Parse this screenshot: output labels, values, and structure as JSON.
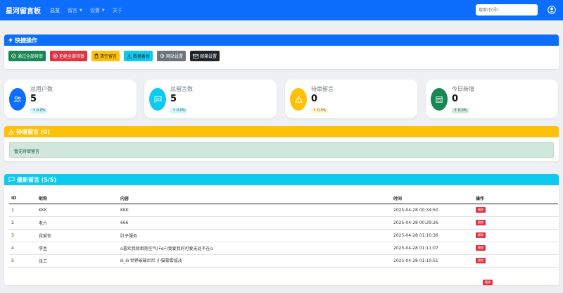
{
  "navbar": {
    "brand": "星河留言板",
    "items": [
      {
        "label": "总览",
        "active": true,
        "dropdown": false
      },
      {
        "label": "留言",
        "active": false,
        "dropdown": true
      },
      {
        "label": "设置",
        "active": false,
        "dropdown": true
      },
      {
        "label": "关于",
        "active": false,
        "dropdown": false
      }
    ],
    "search_placeholder": "搜索(仅号)",
    "user_icon": "person-circle-icon"
  },
  "quick_actions": {
    "title": "快捷操作",
    "buttons": [
      {
        "label": "通过全部待审",
        "color": "#198754",
        "icon": "check-circle-icon"
      },
      {
        "label": "拒绝全部待审",
        "color": "#dc3545",
        "icon": "x-circle-icon"
      },
      {
        "label": "清空留言",
        "color": "#ffc107",
        "icon": "trash-icon"
      },
      {
        "label": "数据备份",
        "color": "#0dcaf0",
        "icon": "download-icon"
      },
      {
        "label": "网站设置",
        "color": "#6c757d",
        "icon": "gear-icon"
      },
      {
        "label": "邮箱设置",
        "color": "#212529",
        "icon": "envelope-icon"
      }
    ]
  },
  "stats": [
    {
      "label": "总用户数",
      "value": "5",
      "badge": "↑ 0.0%",
      "color": "#0d6efd",
      "icon": "people-icon"
    },
    {
      "label": "总留言数",
      "value": "5",
      "badge": "↑ 0.0%",
      "color": "#0dcaf0",
      "icon": "chat-icon"
    },
    {
      "label": "待审留言",
      "value": "0",
      "badge": "↑ 0.0%",
      "color": "#ffc107",
      "icon": "warning-icon"
    },
    {
      "label": "今日新增",
      "value": "0",
      "badge": "↑ 0.0%",
      "color": "#198754",
      "icon": "calendar-icon"
    }
  ],
  "pending": {
    "title": "待审留言 (0)",
    "empty_text": "暂无待审留言"
  },
  "latest": {
    "title": "最新留言 (5/5)",
    "columns": [
      "ID",
      "昵称",
      "内容",
      "时间",
      "操作"
    ],
    "delete_label": "删除",
    "rows": [
      {
        "id": "1",
        "name": "KKK",
        "content": "KKK",
        "time": "2025-04-28 00:34:50"
      },
      {
        "id": "2",
        "name": "老六",
        "content": "666",
        "time": "2025-04-28 00:29:26"
      },
      {
        "id": "3",
        "name": "我爱你",
        "content": "肚子服务",
        "time": "2025-04-28 01:10:36"
      },
      {
        "id": "4",
        "name": "李圣",
        "content": "ɑ喜欢我就相抱空气(•᷄ɞ•᷅)我爱我的可爱无处不在ɑ",
        "time": "2025-04-28 01:11:07"
      },
      {
        "id": "5",
        "name": "张三",
        "content": "ᕱ_ᕱ 世界破破烂烂 小猫雲雲咸淡",
        "time": "2025-04-28 01:10:51"
      }
    ]
  },
  "floating_delete": "删除"
}
